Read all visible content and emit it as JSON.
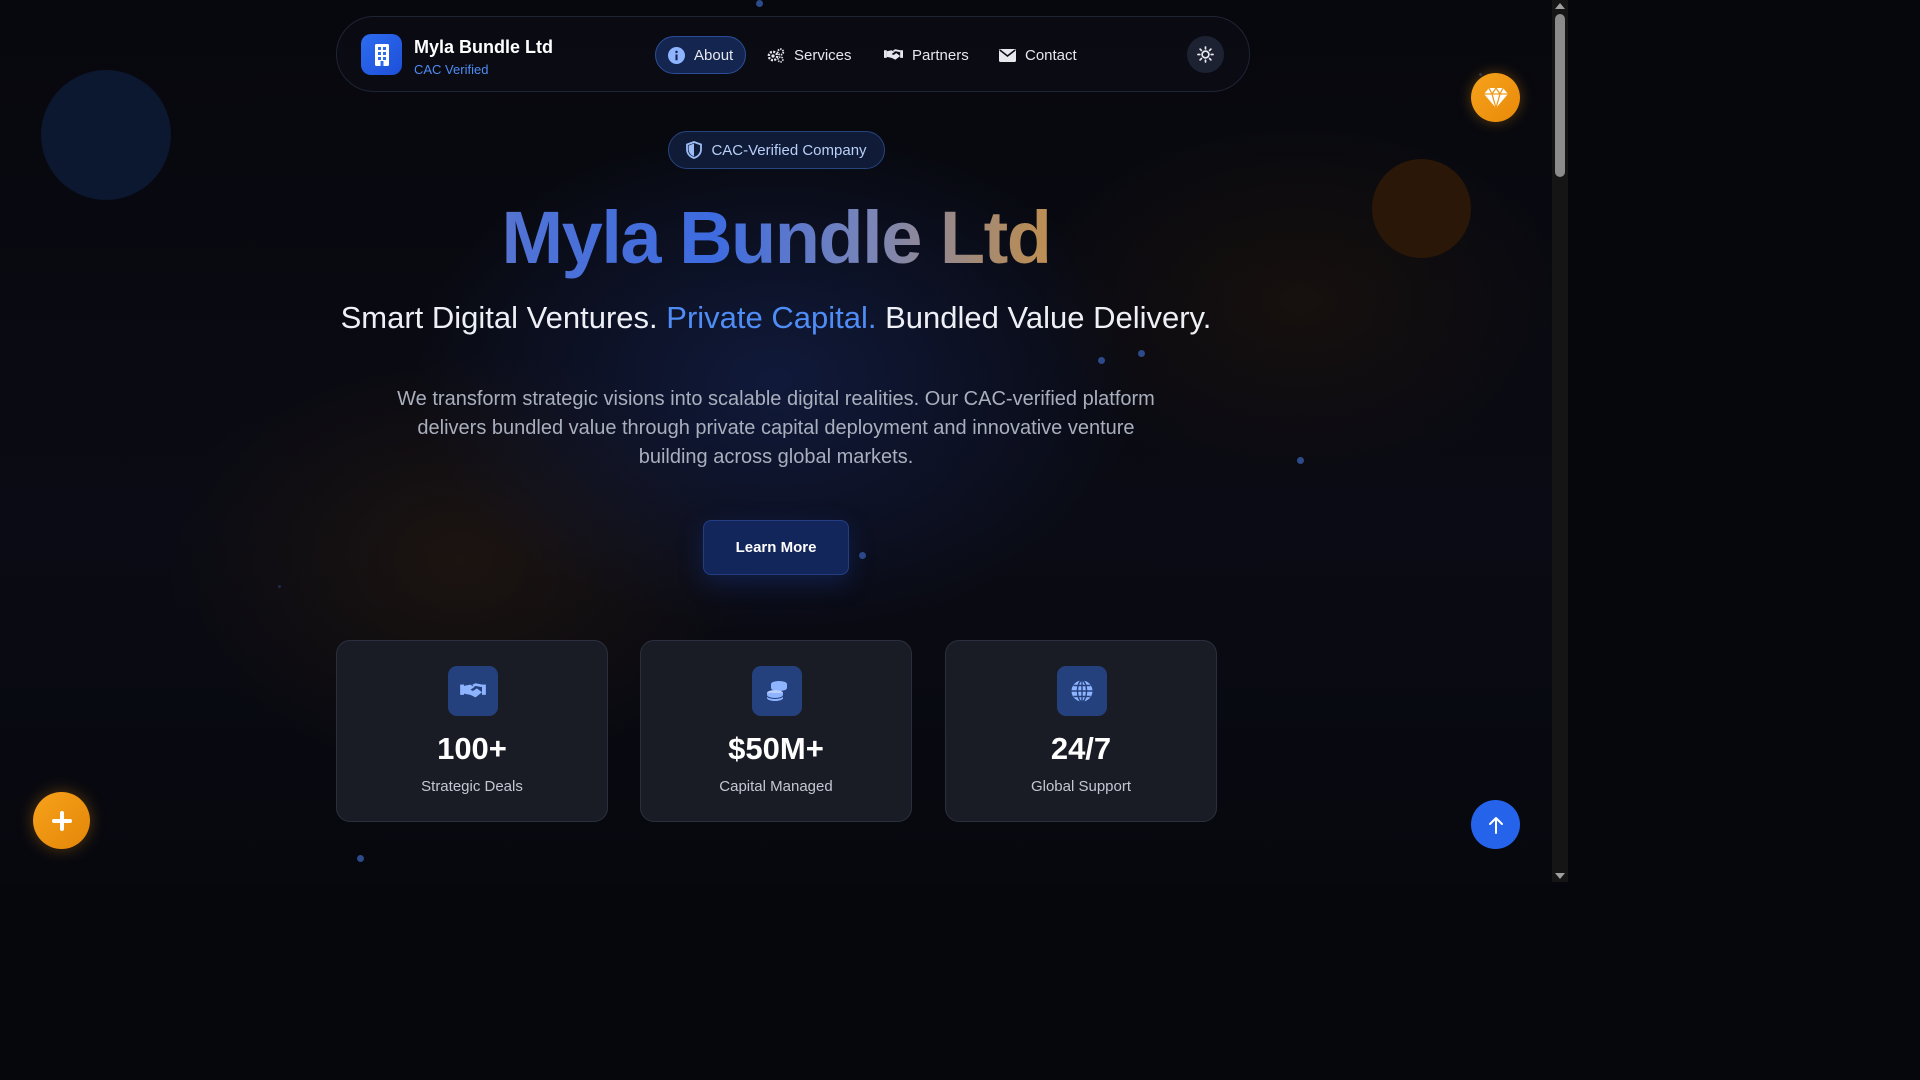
{
  "nav": {
    "brand_name": "Myla Bundle Ltd",
    "brand_sub": "CAC Verified",
    "items": [
      {
        "label": "About",
        "icon": "info-icon",
        "active": true
      },
      {
        "label": "Services",
        "icon": "gears-icon",
        "active": false
      },
      {
        "label": "Partners",
        "icon": "handshake-icon",
        "active": false
      },
      {
        "label": "Contact",
        "icon": "envelope-icon",
        "active": false
      }
    ],
    "theme_icon": "sun-icon"
  },
  "hero": {
    "badge": "CAC-Verified Company",
    "title": "Myla Bundle Ltd",
    "tagline_start": "Smart Digital Ventures.",
    "tagline_highlight": "Private Capital.",
    "tagline_end": "Bundled Value Delivery.",
    "description": "We transform strategic visions into scalable digital realities. Our CAC-verified platform delivers bundled value through private capital deployment and innovative venture building across global markets.",
    "cta": "Learn More"
  },
  "stats": [
    {
      "value": "100+",
      "label": "Strategic Deals",
      "icon": "handshake-icon"
    },
    {
      "value": "$50M+",
      "label": "Capital Managed",
      "icon": "coins-icon"
    },
    {
      "value": "24/7",
      "label": "Global Support",
      "icon": "globe-icon"
    }
  ],
  "floating": {
    "gem_icon": "gem-icon",
    "plus_icon": "plus-icon",
    "up_icon": "arrow-up-icon"
  },
  "colors": {
    "accent_blue": "#4f8cf5",
    "accent_orange": "#f2a62a",
    "background": "#06070c",
    "card": "#1a1c25"
  }
}
